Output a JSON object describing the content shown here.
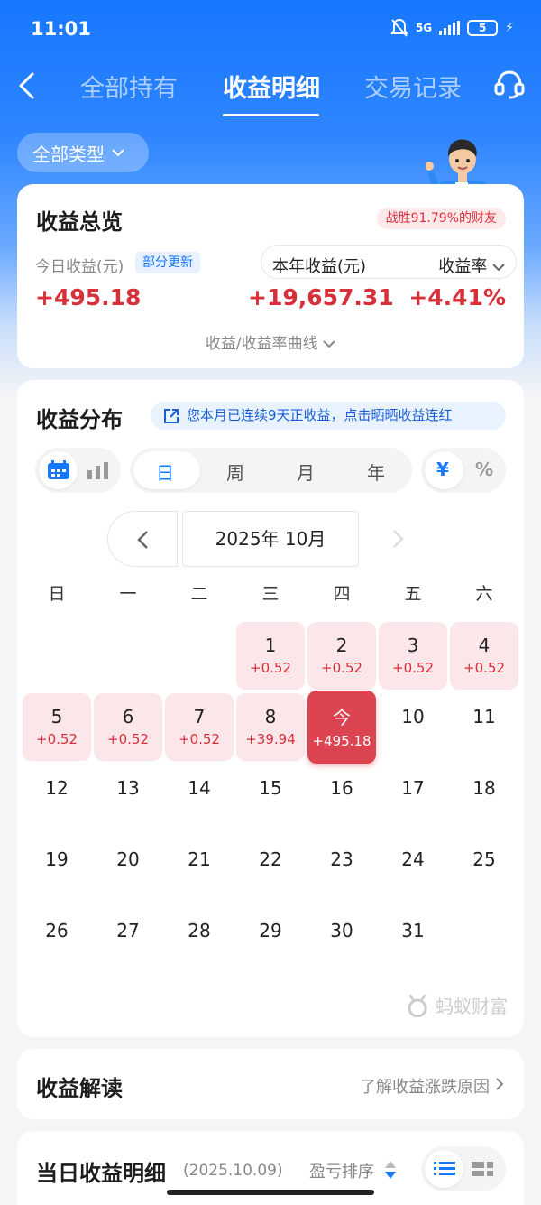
{
  "status_bar": {
    "time": "11:01",
    "network": "5G",
    "battery": "5"
  },
  "nav": {
    "tabs": [
      {
        "label": "全部持有"
      },
      {
        "label": "收益明细"
      },
      {
        "label": "交易记录"
      }
    ]
  },
  "filter": {
    "label": "全部类型"
  },
  "overview": {
    "title": "收益总览",
    "win_badge": "战胜91.79%的财友",
    "today_label": "今日收益(元)",
    "partial_update": "部分更新",
    "today_value": "+495.18",
    "year_label": "本年收益(元)",
    "rate_label": "收益率",
    "year_value": "+19,657.31",
    "rate_value": "+4.41%",
    "curve_link": "收益/收益率曲线"
  },
  "distribution": {
    "title": "收益分布",
    "streak": "您本月已连续9天正收益，点击晒晒收益连红",
    "periods": [
      "日",
      "周",
      "月",
      "年"
    ],
    "units": [
      "¥",
      "%"
    ],
    "month": "2025年 10月",
    "weekdays": [
      "日",
      "一",
      "二",
      "三",
      "四",
      "五",
      "六"
    ],
    "days": [
      {
        "n": "1",
        "v": "+0.52"
      },
      {
        "n": "2",
        "v": "+0.52"
      },
      {
        "n": "3",
        "v": "+0.52"
      },
      {
        "n": "4",
        "v": "+0.52"
      },
      {
        "n": "5",
        "v": "+0.52"
      },
      {
        "n": "6",
        "v": "+0.52"
      },
      {
        "n": "7",
        "v": "+0.52"
      },
      {
        "n": "8",
        "v": "+39.94"
      },
      {
        "n": "今",
        "v": "+495.18"
      },
      {
        "n": "10",
        "v": ""
      },
      {
        "n": "11",
        "v": ""
      },
      {
        "n": "12",
        "v": ""
      },
      {
        "n": "13",
        "v": ""
      },
      {
        "n": "14",
        "v": ""
      },
      {
        "n": "15",
        "v": ""
      },
      {
        "n": "16",
        "v": ""
      },
      {
        "n": "17",
        "v": ""
      },
      {
        "n": "18",
        "v": ""
      },
      {
        "n": "19",
        "v": ""
      },
      {
        "n": "20",
        "v": ""
      },
      {
        "n": "21",
        "v": ""
      },
      {
        "n": "22",
        "v": ""
      },
      {
        "n": "23",
        "v": ""
      },
      {
        "n": "24",
        "v": ""
      },
      {
        "n": "25",
        "v": ""
      },
      {
        "n": "26",
        "v": ""
      },
      {
        "n": "27",
        "v": ""
      },
      {
        "n": "28",
        "v": ""
      },
      {
        "n": "29",
        "v": ""
      },
      {
        "n": "30",
        "v": ""
      },
      {
        "n": "31",
        "v": ""
      }
    ],
    "watermark": "蚂蚁财富"
  },
  "interpretation": {
    "title": "收益解读",
    "link": "了解收益涨跌原因"
  },
  "daily_detail": {
    "title": "当日收益明细",
    "date": "(2025.10.09)",
    "sort": "盈亏排序"
  },
  "colors": {
    "primary": "#1677ff",
    "profit": "#d8303b",
    "today_bg": "#dc4452"
  }
}
